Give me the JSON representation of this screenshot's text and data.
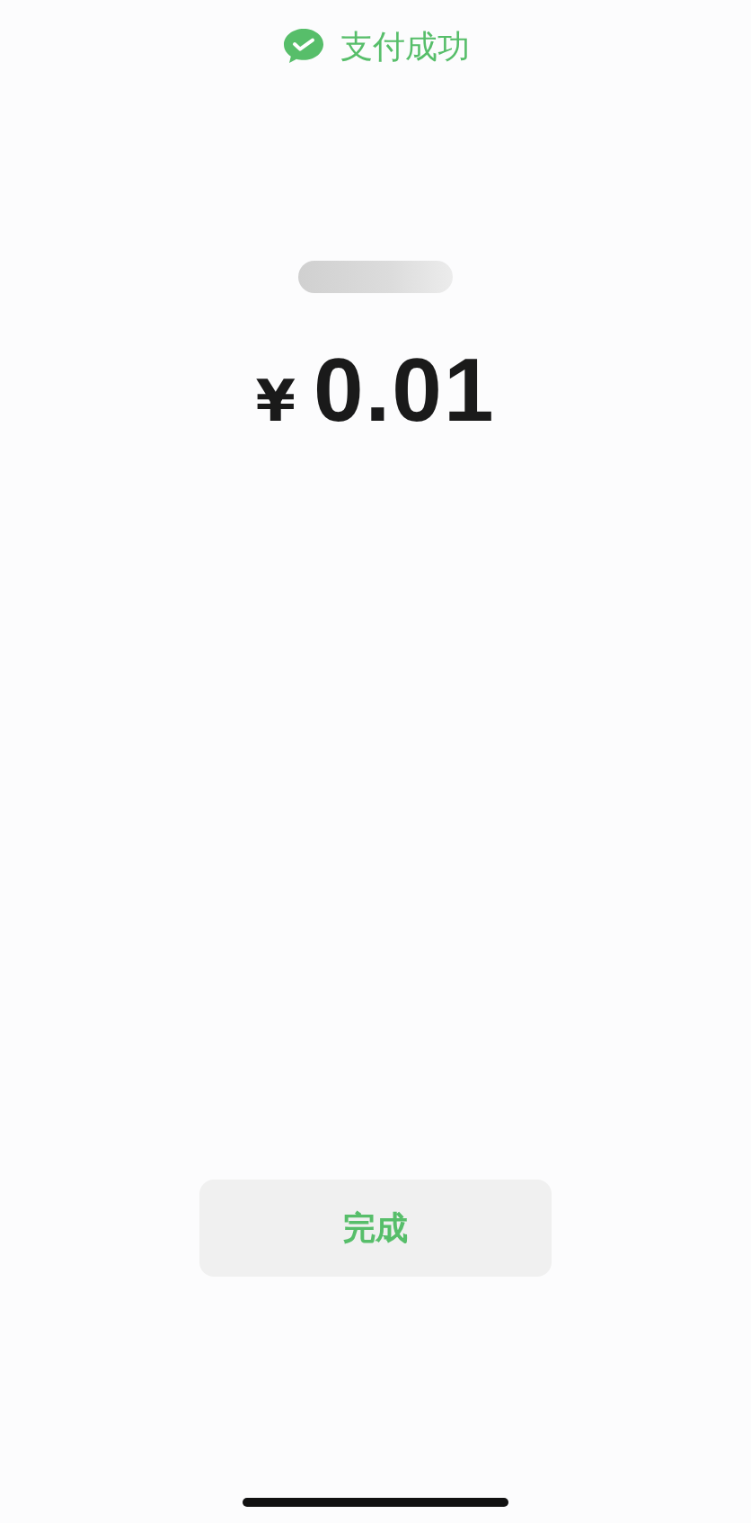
{
  "header": {
    "title": "支付成功"
  },
  "payment": {
    "currency": "¥",
    "amount": "0.01"
  },
  "buttons": [
    "完成"
  ]
}
